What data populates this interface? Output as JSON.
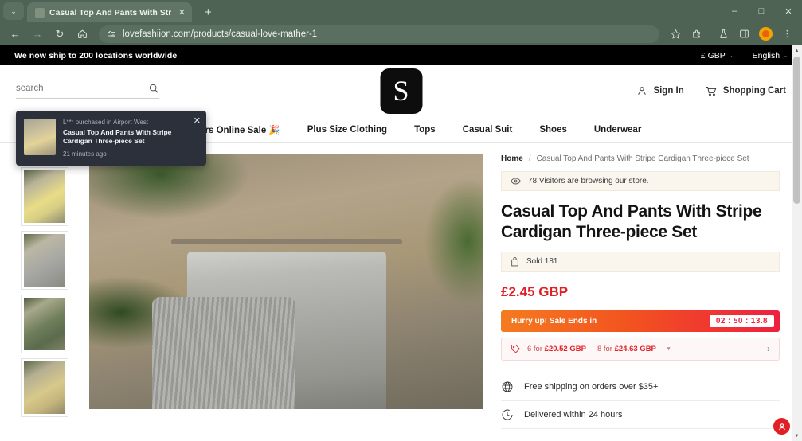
{
  "browser": {
    "tab": {
      "title": "Casual Top And Pants With Str",
      "close_label": "✕"
    },
    "new_tab_label": "+",
    "tab_list_label": "⌄",
    "nav": {
      "back": "←",
      "forward": "→",
      "reload": "↻",
      "home": "⌂"
    },
    "url": "lovefashiion.com/products/casual-love-mather-1",
    "window": {
      "minimize": "–",
      "maximize": "□",
      "close": "✕"
    },
    "toolbar_icons": [
      "star-icon",
      "extensions-icon",
      "lab-flask-icon",
      "side-panel-icon",
      "profile-avatar",
      "chrome-menu-icon"
    ]
  },
  "announcement": {
    "message": "We now ship to 200 locations worldwide",
    "currency": "£ GBP",
    "language": "English",
    "caret": "⌄"
  },
  "header": {
    "search_placeholder": "search",
    "search_value": "",
    "logo_letter": "S",
    "sign_in": "Sign In",
    "cart": "Shopping Cart"
  },
  "nav": {
    "items": [
      {
        "label": "🎉 24 Hours Online Sale 🎉"
      },
      {
        "label": "Plus Size Clothing"
      },
      {
        "label": "Tops"
      },
      {
        "label": "Casual Suit"
      },
      {
        "label": "Shoes"
      },
      {
        "label": "Underwear"
      }
    ]
  },
  "toast": {
    "meta": "L**r purchased in Airport West",
    "title": "Casual Top And Pants With Stripe Cardigan Three-piece Set",
    "time": "21 minutes ago",
    "close": "✕"
  },
  "gallery": {
    "scroll_up": "∧",
    "thumbs": [
      {
        "name": "thumbnail-yellow-set"
      },
      {
        "name": "thumbnail-grey-set"
      },
      {
        "name": "thumbnail-green-set"
      },
      {
        "name": "thumbnail-tan-set"
      }
    ]
  },
  "product": {
    "breadcrumb_home": "Home",
    "breadcrumb_sep": "/",
    "breadcrumb_current": "Casual Top And Pants With Stripe Cardigan Three-piece Set",
    "visitors": "78 Visitors are browsing our store.",
    "title": "Casual Top And Pants With Stripe Cardigan Three-piece Set",
    "sold": "Sold 181",
    "price": "£2.45 GBP",
    "hurry_label": "Hurry up! Sale Ends in",
    "timer": "02 : 50 : 13.8",
    "bundle": [
      {
        "qty": "6 for",
        "price": "£20.52 GBP"
      },
      {
        "qty": "8 for",
        "price": "£24.63 GBP"
      }
    ],
    "bundle_caret": "▾",
    "bundle_arrow": "›",
    "perks": [
      {
        "icon": "globe-icon",
        "text": "Free shipping on orders over $35+"
      },
      {
        "icon": "delivery-icon",
        "text": "Delivered within 24 hours"
      }
    ]
  },
  "colors": {
    "chrome": "#4e6353",
    "accent_red": "#e01f26",
    "announce_bg": "#000000",
    "toast_bg": "#2b303b"
  }
}
